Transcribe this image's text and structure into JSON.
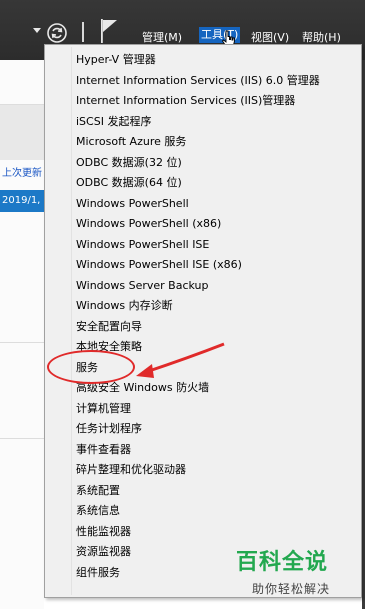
{
  "menubar": {
    "items": [
      {
        "label": "管理(M)"
      },
      {
        "label": "工具(T)"
      },
      {
        "label": "视图(V)"
      },
      {
        "label": "帮助(H)"
      }
    ]
  },
  "background": {
    "link_text": "上次更新",
    "selected_row": "2019/1,"
  },
  "tools_menu": {
    "items": [
      "Hyper-V 管理器",
      "Internet Information Services (IIS) 6.0 管理器",
      "Internet Information Services (IIS)管理器",
      "iSCSI 发起程序",
      "Microsoft Azure 服务",
      "ODBC 数据源(32 位)",
      "ODBC 数据源(64 位)",
      "Windows PowerShell",
      "Windows PowerShell (x86)",
      "Windows PowerShell ISE",
      "Windows PowerShell ISE (x86)",
      "Windows Server Backup",
      "Windows 内存诊断",
      "安全配置向导",
      "本地安全策略",
      "服务",
      "高级安全 Windows 防火墙",
      "计算机管理",
      "任务计划程序",
      "事件查看器",
      "碎片整理和优化驱动器",
      "系统配置",
      "系统信息",
      "性能监视器",
      "资源监视器",
      "组件服务"
    ]
  },
  "watermark": {
    "title": "百科全说",
    "subtitle": "助你轻松解决"
  },
  "colors": {
    "toolbar": "#2c2c2c",
    "active_menu": "#1565c0",
    "annotation": "#e02a2a",
    "watermark": "#23a84f"
  }
}
